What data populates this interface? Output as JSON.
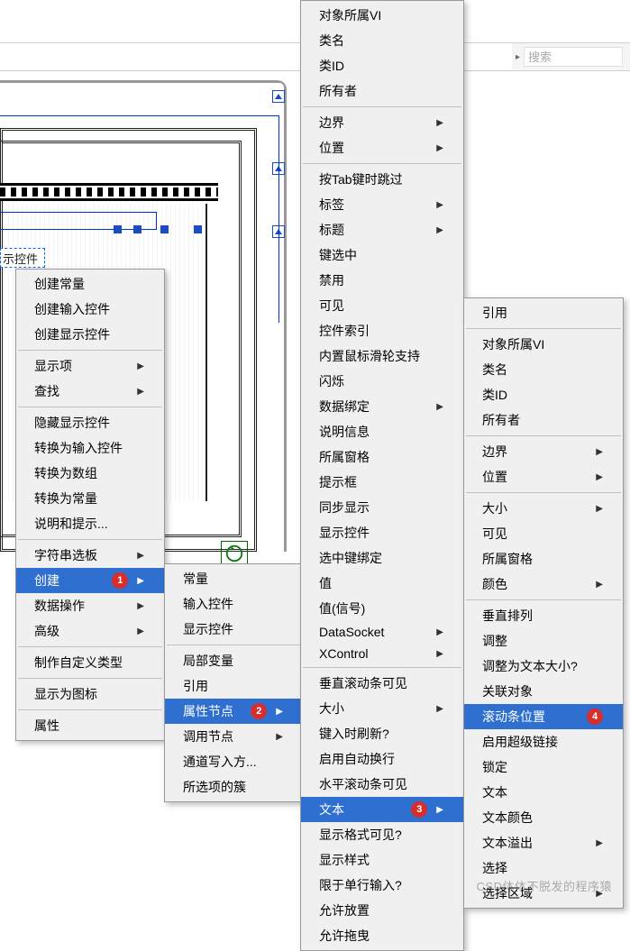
{
  "toolbar": {
    "search_placeholder": "搜索"
  },
  "diagram": {
    "control_label": "示控件"
  },
  "menu1": {
    "groups": [
      {
        "items": [
          {
            "label": "创建常量"
          },
          {
            "label": "创建输入控件"
          },
          {
            "label": "创建显示控件"
          }
        ]
      },
      {
        "items": [
          {
            "label": "显示项",
            "submenu": true
          },
          {
            "label": "查找",
            "submenu": true
          }
        ]
      },
      {
        "items": [
          {
            "label": "隐藏显示控件"
          },
          {
            "label": "转换为输入控件"
          },
          {
            "label": "转换为数组"
          },
          {
            "label": "转换为常量"
          },
          {
            "label": "说明和提示..."
          }
        ]
      },
      {
        "items": [
          {
            "label": "字符串选板",
            "submenu": true
          },
          {
            "label": "创建",
            "submenu": true,
            "highlight": true,
            "badge": "1"
          },
          {
            "label": "数据操作",
            "submenu": true
          },
          {
            "label": "高级",
            "submenu": true
          }
        ]
      },
      {
        "items": [
          {
            "label": "制作自定义类型"
          }
        ]
      },
      {
        "items": [
          {
            "label": "显示为图标"
          }
        ]
      },
      {
        "items": [
          {
            "label": "属性"
          }
        ]
      }
    ]
  },
  "menu2": {
    "groups": [
      {
        "items": [
          {
            "label": "常量"
          },
          {
            "label": "输入控件"
          },
          {
            "label": "显示控件"
          }
        ]
      },
      {
        "items": [
          {
            "label": "局部变量"
          },
          {
            "label": "引用"
          },
          {
            "label": "属性节点",
            "submenu": true,
            "highlight": true,
            "badge": "2"
          },
          {
            "label": "调用节点",
            "submenu": true
          },
          {
            "label": "通道写入方..."
          },
          {
            "label": "所选项的簇"
          }
        ]
      }
    ]
  },
  "menu3": {
    "groups": [
      {
        "items": [
          {
            "label": "对象所属VI"
          },
          {
            "label": "类名"
          },
          {
            "label": "类ID"
          },
          {
            "label": "所有者"
          }
        ]
      },
      {
        "items": [
          {
            "label": "边界",
            "submenu": true
          },
          {
            "label": "位置",
            "submenu": true
          }
        ]
      },
      {
        "items": [
          {
            "label": "按Tab键时跳过"
          },
          {
            "label": "标签",
            "submenu": true
          },
          {
            "label": "标题",
            "submenu": true
          },
          {
            "label": "键选中"
          },
          {
            "label": "禁用"
          },
          {
            "label": "可见"
          },
          {
            "label": "控件索引"
          },
          {
            "label": "内置鼠标滑轮支持"
          },
          {
            "label": "闪烁"
          },
          {
            "label": "数据绑定",
            "submenu": true
          },
          {
            "label": "说明信息"
          },
          {
            "label": "所属窗格"
          },
          {
            "label": "提示框"
          },
          {
            "label": "同步显示"
          },
          {
            "label": "显示控件"
          },
          {
            "label": "选中键绑定"
          },
          {
            "label": "值"
          },
          {
            "label": "值(信号)"
          },
          {
            "label": "DataSocket",
            "submenu": true
          },
          {
            "label": "XControl",
            "submenu": true
          }
        ]
      },
      {
        "items": [
          {
            "label": "垂直滚动条可见"
          },
          {
            "label": "大小",
            "submenu": true
          },
          {
            "label": "键入时刷新?"
          },
          {
            "label": "启用自动换行"
          },
          {
            "label": "水平滚动条可见"
          },
          {
            "label": "文本",
            "submenu": true,
            "highlight": true,
            "badge": "3"
          },
          {
            "label": "显示格式可见?"
          },
          {
            "label": "显示样式"
          },
          {
            "label": "限于单行输入?"
          },
          {
            "label": "允许放置"
          },
          {
            "label": "允许拖曳"
          }
        ]
      }
    ]
  },
  "menu4": {
    "groups": [
      {
        "items": [
          {
            "label": "引用"
          }
        ]
      },
      {
        "items": [
          {
            "label": "对象所属VI"
          },
          {
            "label": "类名"
          },
          {
            "label": "类ID"
          },
          {
            "label": "所有者"
          }
        ]
      },
      {
        "items": [
          {
            "label": "边界",
            "submenu": true
          },
          {
            "label": "位置",
            "submenu": true
          }
        ]
      },
      {
        "items": [
          {
            "label": "大小",
            "submenu": true
          },
          {
            "label": "可见"
          },
          {
            "label": "所属窗格"
          },
          {
            "label": "颜色",
            "submenu": true
          }
        ]
      },
      {
        "items": [
          {
            "label": "垂直排列"
          },
          {
            "label": "调整"
          },
          {
            "label": "调整为文本大小?"
          },
          {
            "label": "关联对象"
          },
          {
            "label": "滚动条位置",
            "highlight": true,
            "badge": "4"
          },
          {
            "label": "启用超级链接"
          },
          {
            "label": "锁定"
          },
          {
            "label": "文本"
          },
          {
            "label": "文本颜色"
          },
          {
            "label": "文本溢出",
            "submenu": true
          },
          {
            "label": "选择"
          },
          {
            "label": "选择区域",
            "submenu": true
          }
        ]
      }
    ]
  },
  "watermark": "CSD体体不脱发的程序猿"
}
